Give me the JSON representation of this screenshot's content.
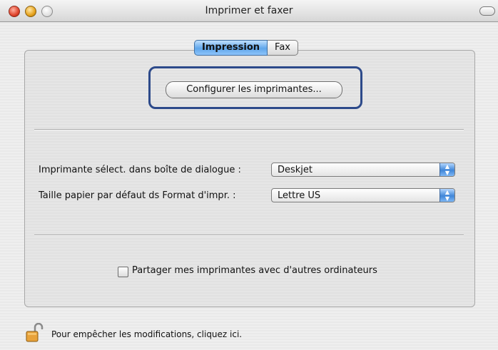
{
  "window": {
    "title": "Imprimer et faxer",
    "traffic_lights": [
      "close-light",
      "minimize-light",
      "zoom-light"
    ]
  },
  "tabs": [
    {
      "label": "Impression",
      "selected": true
    },
    {
      "label": "Fax",
      "selected": false
    }
  ],
  "configure_button": {
    "label": "Configurer les imprimantes..."
  },
  "printer_select": {
    "label": "Imprimante sélect. dans boîte de dialogue :",
    "value": "Deskjet"
  },
  "paper_size": {
    "label": "Taille papier par défaut ds Format d'impr. :",
    "value": "Lettre US"
  },
  "share": {
    "label": "Partager mes imprimantes avec d'autres ordinateurs",
    "checked": false
  },
  "lock": {
    "icon": "padlock-icon",
    "text": "Pour empêcher les modifications, cliquez ici."
  }
}
